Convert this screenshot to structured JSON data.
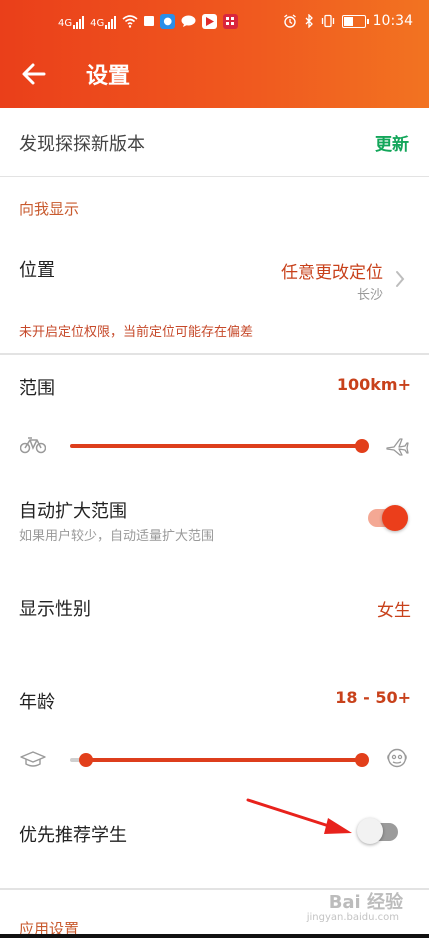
{
  "status_bar": {
    "signal1": "4G",
    "signal2": "4G",
    "time": "10:34"
  },
  "header": {
    "title": "设置"
  },
  "update": {
    "label": "发现探探新版本",
    "action": "更新"
  },
  "show_me_section": {
    "title": "向我显示"
  },
  "location": {
    "label": "位置",
    "value": "任意更改定位",
    "sub": "长沙",
    "warning": "未开启定位权限，当前定位可能存在偏差"
  },
  "range": {
    "label": "范围",
    "value": "100km+",
    "slider_fraction": 1.0
  },
  "auto_expand": {
    "label": "自动扩大范围",
    "sub": "如果用户较少，自动适量扩大范围",
    "enabled": true
  },
  "gender": {
    "label": "显示性别",
    "value": "女生"
  },
  "age": {
    "label": "年龄",
    "value": "18 - 50+",
    "min_fraction": 0.0,
    "max_fraction": 1.0
  },
  "students": {
    "label": "优先推荐学生",
    "enabled": false
  },
  "app_settings_section": {
    "title": "应用设置"
  },
  "watermark": {
    "text": "Bai 经验",
    "sub": "jingyan.baidu.com"
  },
  "colors": {
    "accent": "#e23f1b",
    "header_start": "#ea3f1a",
    "header_end": "#f27321",
    "update_green": "#13a65a"
  }
}
